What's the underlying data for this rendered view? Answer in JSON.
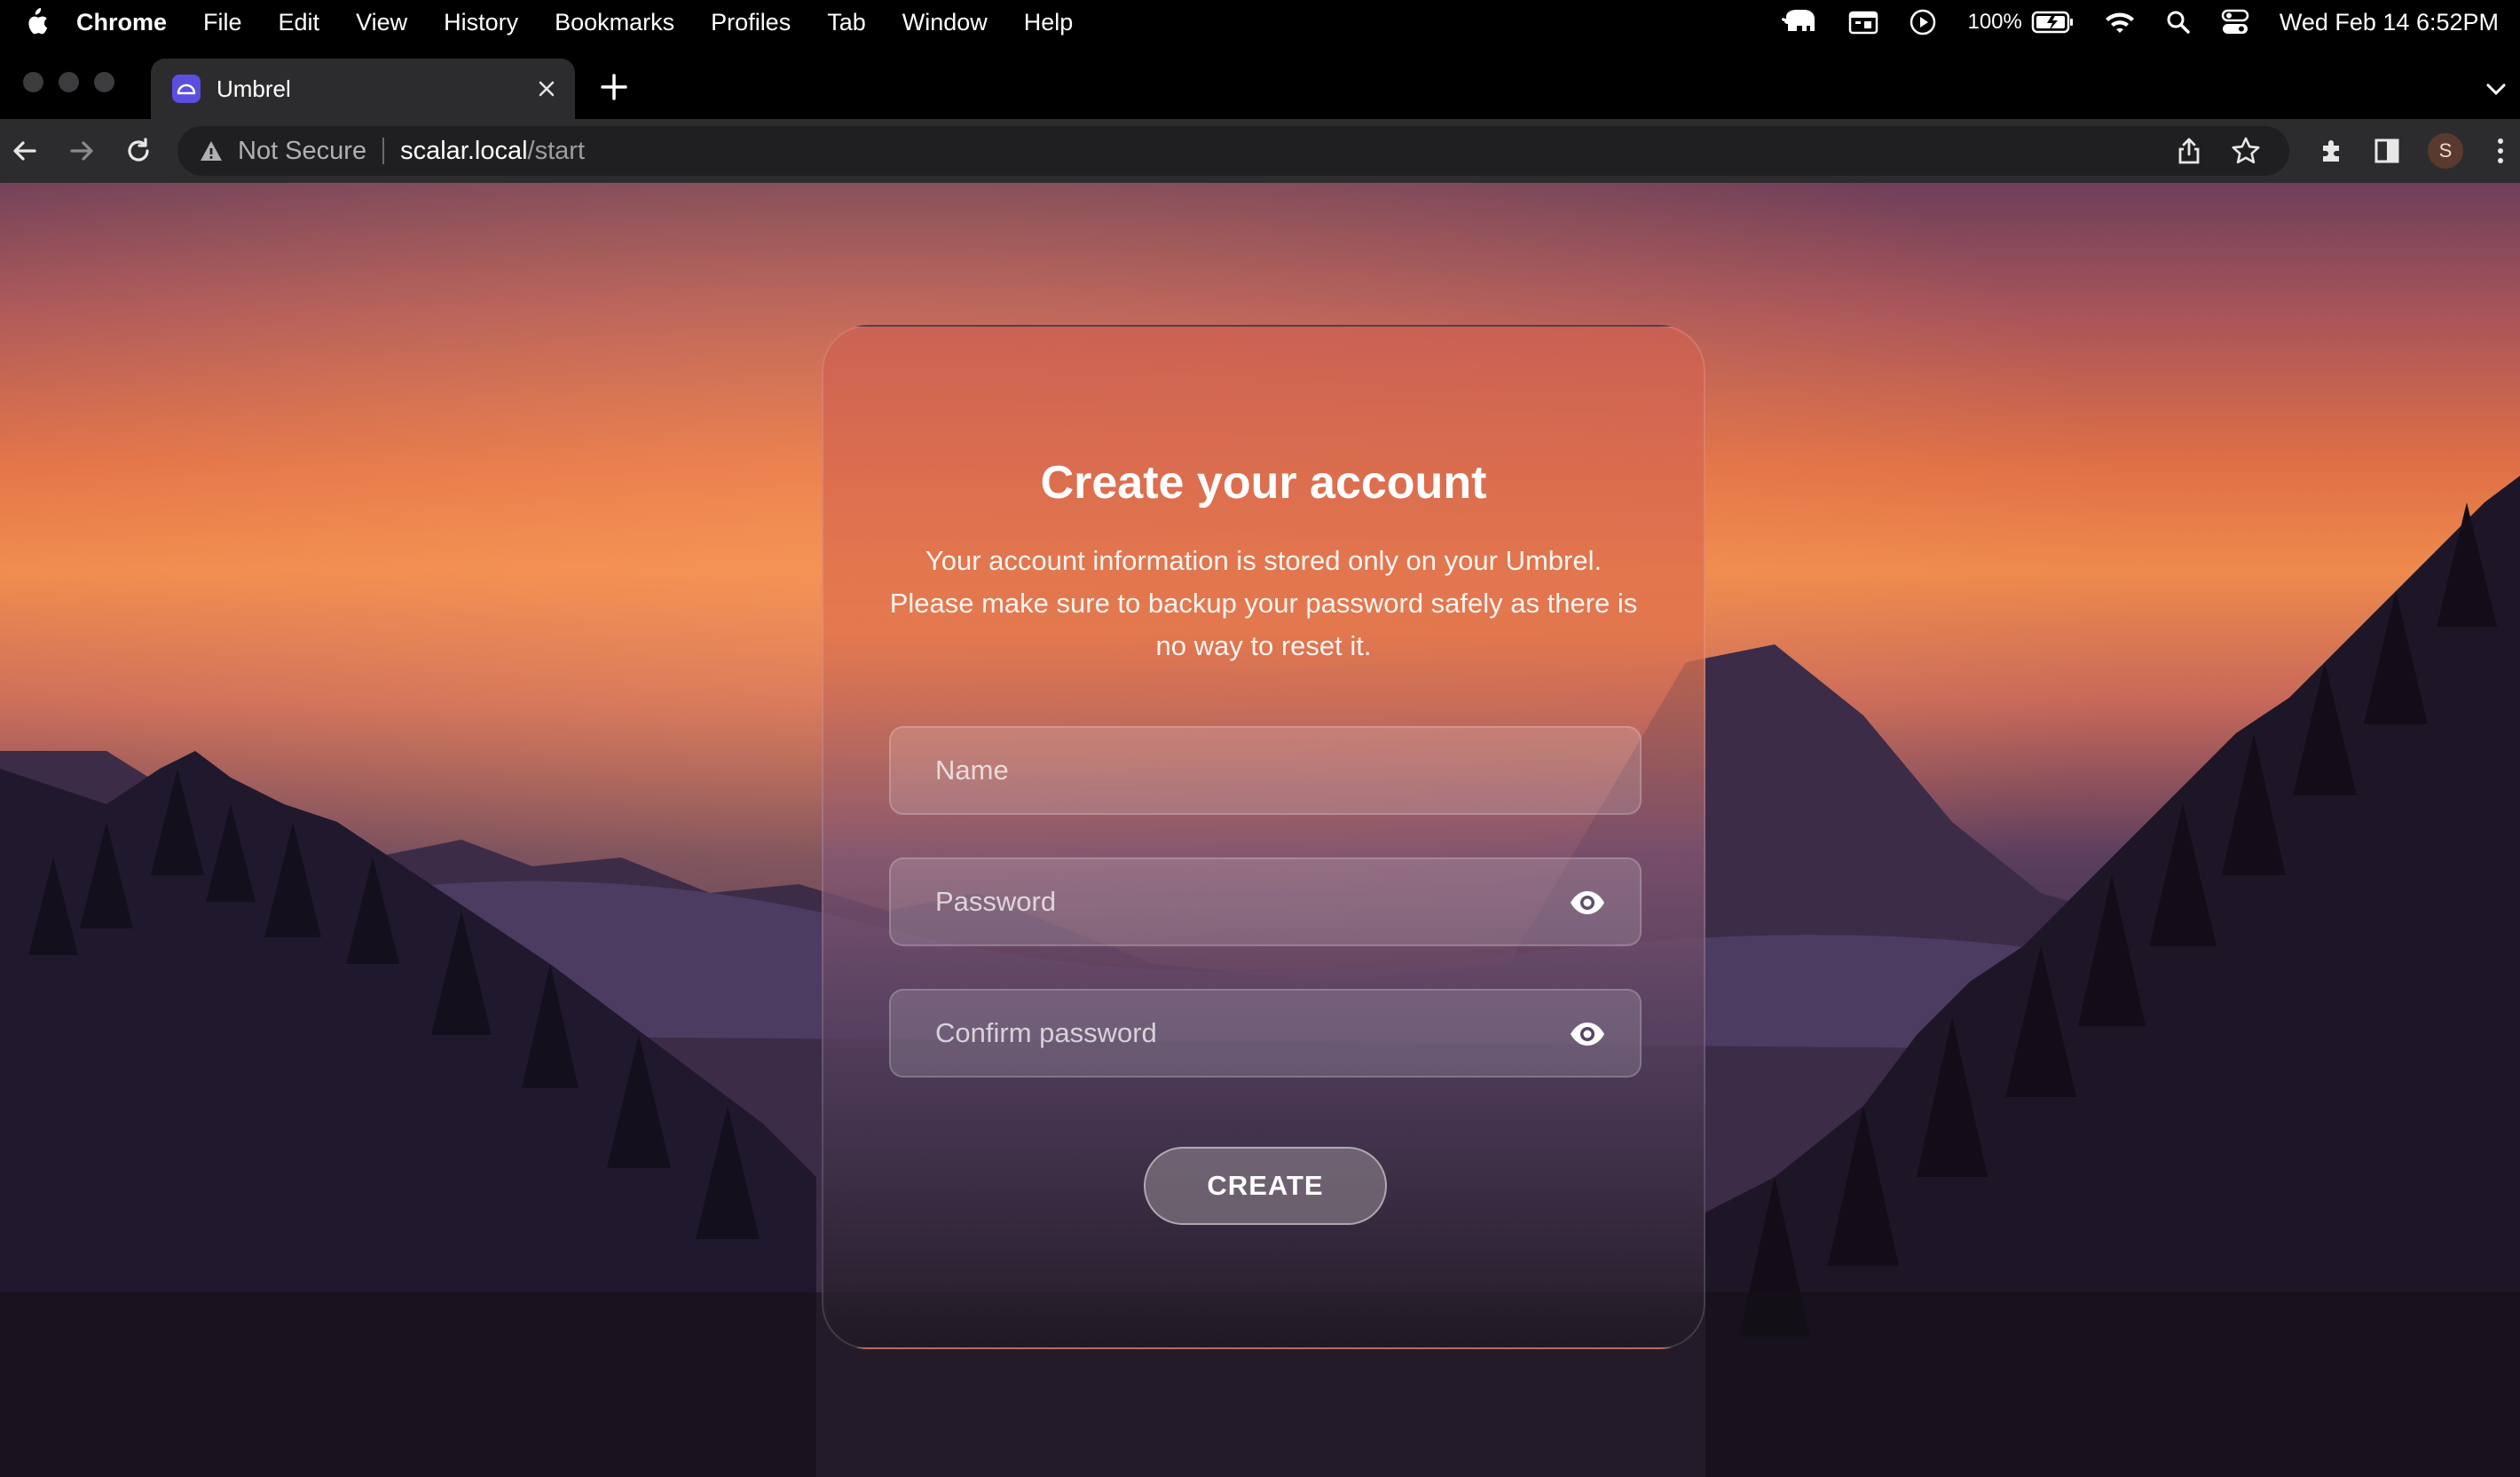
{
  "menubar": {
    "app_name": "Chrome",
    "items": [
      "File",
      "Edit",
      "View",
      "History",
      "Bookmarks",
      "Profiles",
      "Tab",
      "Window",
      "Help"
    ],
    "battery": "100%",
    "datetime": "Wed Feb 14  6:52PM",
    "status_icons": [
      "elephant-icon",
      "calendar-icon",
      "play-circle-icon",
      "battery-icon",
      "wifi-icon",
      "search-icon",
      "control-center-icon"
    ]
  },
  "tab": {
    "title": "Umbrel"
  },
  "address_bar": {
    "security_label": "Not Secure",
    "host": "scalar.local",
    "path": "/start"
  },
  "profile": {
    "initial": "S"
  },
  "form": {
    "heading": "Create your account",
    "description": "Your account information is stored only on your Umbrel. Please make sure to backup your password safely as there is no way to reset it.",
    "name_placeholder": "Name",
    "password_placeholder": "Password",
    "confirm_placeholder": "Confirm password",
    "submit_label": "CREATE"
  },
  "colors": {
    "brand_favicon": "#5b4fe0",
    "sky_orange": "#ee8a4c",
    "dusk_purple": "#2d2340"
  }
}
